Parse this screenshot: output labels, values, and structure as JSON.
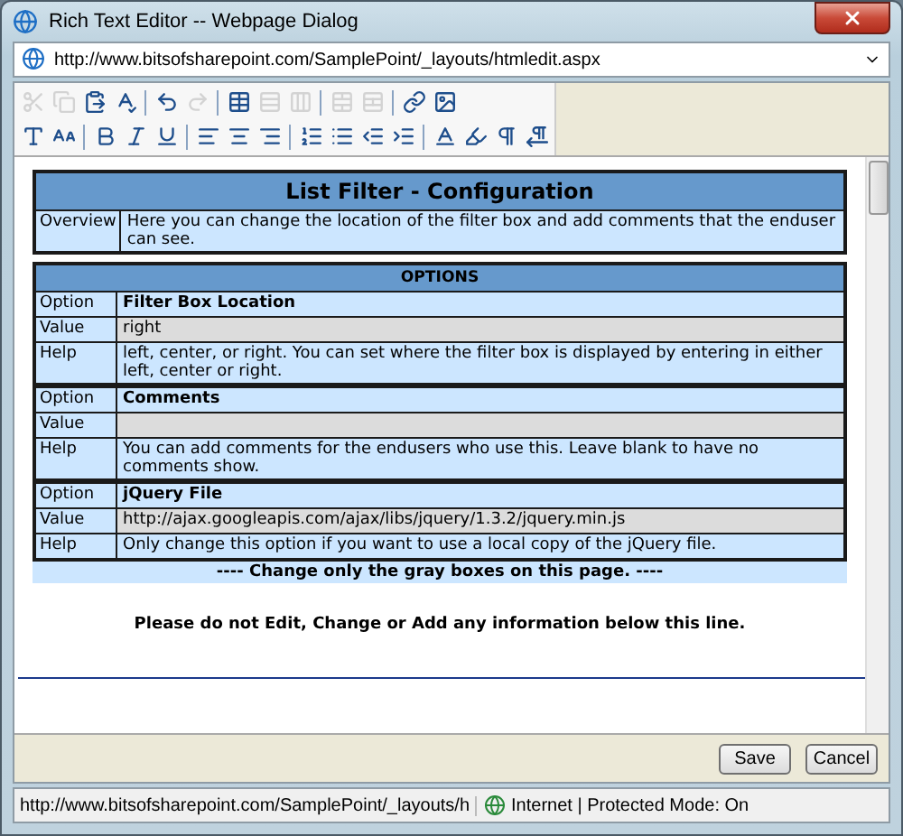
{
  "window": {
    "title": "Rich Text Editor -- Webpage Dialog"
  },
  "address": "http://www.bitsofsharepoint.com/SamplePoint/_layouts/htmledit.aspx",
  "toolbar": {
    "rows": [
      [
        {
          "kind": "cut",
          "disabled": true
        },
        {
          "kind": "copy",
          "disabled": true
        },
        {
          "kind": "paste",
          "disabled": false
        },
        {
          "kind": "spellcheck",
          "disabled": false
        },
        {
          "kind": "separator"
        },
        {
          "kind": "undo",
          "disabled": false
        },
        {
          "kind": "redo",
          "disabled": true
        },
        {
          "kind": "separator"
        },
        {
          "kind": "table",
          "disabled": false
        },
        {
          "kind": "insert-row",
          "disabled": true
        },
        {
          "kind": "insert-column",
          "disabled": true
        },
        {
          "kind": "separator"
        },
        {
          "kind": "merge-cells",
          "disabled": true
        },
        {
          "kind": "split-cells",
          "disabled": true
        },
        {
          "kind": "separator"
        },
        {
          "kind": "link",
          "disabled": false
        },
        {
          "kind": "image",
          "disabled": false
        }
      ],
      [
        {
          "kind": "font",
          "disabled": false
        },
        {
          "kind": "font-size",
          "disabled": false
        },
        {
          "kind": "separator"
        },
        {
          "kind": "bold",
          "disabled": false
        },
        {
          "kind": "italic",
          "disabled": false
        },
        {
          "kind": "underline",
          "disabled": false
        },
        {
          "kind": "separator"
        },
        {
          "kind": "align-left",
          "disabled": false
        },
        {
          "kind": "align-center",
          "disabled": false
        },
        {
          "kind": "align-right",
          "disabled": false
        },
        {
          "kind": "separator"
        },
        {
          "kind": "ordered-list",
          "disabled": false
        },
        {
          "kind": "unordered-list",
          "disabled": false
        },
        {
          "kind": "outdent",
          "disabled": false
        },
        {
          "kind": "indent",
          "disabled": false
        },
        {
          "kind": "separator"
        },
        {
          "kind": "font-color",
          "disabled": false
        },
        {
          "kind": "highlight",
          "disabled": false
        },
        {
          "kind": "ltr",
          "disabled": false
        },
        {
          "kind": "rtl",
          "disabled": false
        }
      ]
    ]
  },
  "document": {
    "title": "List Filter - Configuration",
    "overview": {
      "label": "Overview",
      "text": "Here you can change the location of the filter box and add comments that the enduser can see."
    },
    "options_header": "OPTIONS",
    "options": [
      {
        "rows": [
          {
            "kind": "option",
            "label": "Option",
            "text": "Filter Box Location"
          },
          {
            "kind": "value",
            "label": "Value",
            "text": "right"
          },
          {
            "kind": "help",
            "label": "Help",
            "text": "left, center, or right. You can set where the filter box is displayed by entering in either left, center or right."
          }
        ]
      },
      {
        "rows": [
          {
            "kind": "option",
            "label": "Option",
            "text": "Comments"
          },
          {
            "kind": "value",
            "label": "Value",
            "text": ""
          },
          {
            "kind": "help",
            "label": "Help",
            "text": "You can add comments for the endusers who use this. Leave blank to have no comments show."
          }
        ]
      },
      {
        "rows": [
          {
            "kind": "option",
            "label": "Option",
            "text": "jQuery File"
          },
          {
            "kind": "value",
            "label": "Value",
            "text": "http://ajax.googleapis.com/ajax/libs/jquery/1.3.2/jquery.min.js"
          },
          {
            "kind": "help",
            "label": "Help",
            "text": "Only change this option if you want to use a local copy of the jQuery file."
          }
        ]
      }
    ],
    "note": "---- Change only the gray boxes on this page. ----",
    "warning": "Please do not Edit, Change or Add any information below this line."
  },
  "buttons": [
    "Save",
    "Cancel"
  ],
  "status_bar": {
    "url": "http://www.bitsofsharepoint.com/SamplePoint/_layouts/h",
    "zone": "Internet | Protected Mode: On"
  }
}
